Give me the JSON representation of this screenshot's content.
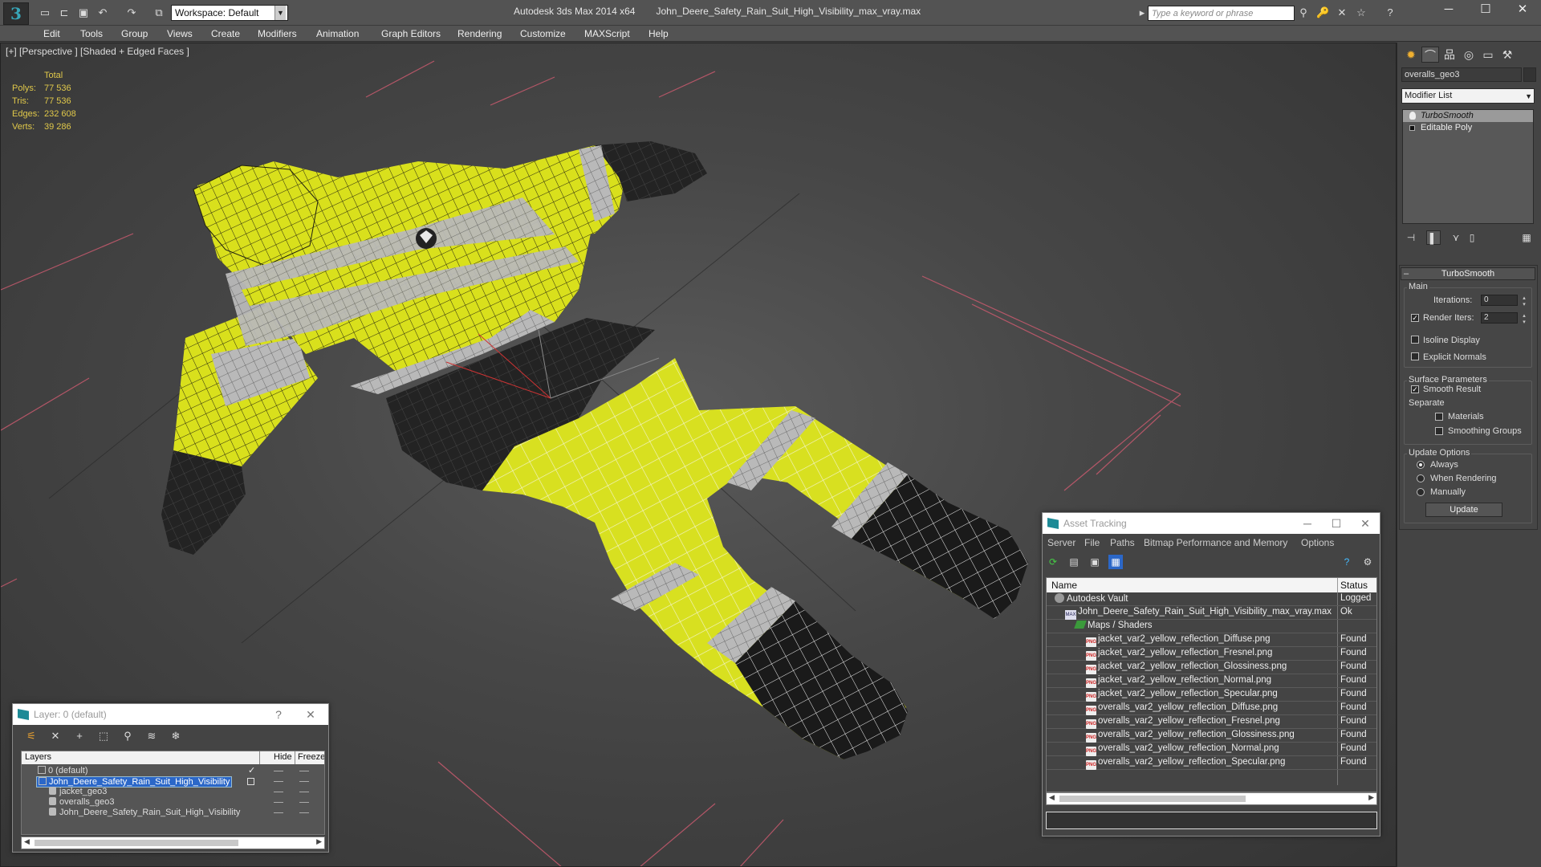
{
  "app": {
    "workspace": "Workspace: Default",
    "product": "Autodesk 3ds Max  2014 x64",
    "filename": "John_Deere_Safety_Rain_Suit_High_Visibility_max_vray.max",
    "search_placeholder": "Type a keyword or phrase"
  },
  "menu": [
    "Edit",
    "Tools",
    "Group",
    "Views",
    "Create",
    "Modifiers",
    "Animation",
    "Graph Editors",
    "Rendering",
    "Customize",
    "MAXScript",
    "Help"
  ],
  "viewport": {
    "label": "[+] [Perspective ] [Shaded + Edged Faces ]",
    "stats_header": "Total",
    "stats": [
      {
        "key": "Polys:",
        "value": "77 536"
      },
      {
        "key": "Tris:",
        "value": "77 536"
      },
      {
        "key": "Edges:",
        "value": "232 608"
      },
      {
        "key": "Verts:",
        "value": "39 286"
      }
    ]
  },
  "command_panel": {
    "object_name": "overalls_geo3",
    "modifier_list": "Modifier List",
    "stack": [
      {
        "label": "TurboSmooth",
        "selected": true
      },
      {
        "label": "Editable Poly",
        "selected": false
      }
    ],
    "rollout_title": "TurboSmooth",
    "main_label": "Main",
    "iterations_label": "Iterations:",
    "iterations_value": "0",
    "render_iters_label": "Render Iters:",
    "render_iters_value": "2",
    "isoline_label": "Isoline Display",
    "explicit_normals_label": "Explicit Normals",
    "surface_params_label": "Surface Parameters",
    "smooth_result_label": "Smooth Result",
    "separate_label": "Separate",
    "materials_label": "Materials",
    "smoothing_groups_label": "Smoothing Groups",
    "update_options_label": "Update Options",
    "always_label": "Always",
    "when_rendering_label": "When Rendering",
    "manually_label": "Manually",
    "update_button": "Update"
  },
  "asset_tracking": {
    "title": "Asset Tracking",
    "menu": [
      "Server",
      "File",
      "Paths",
      "Bitmap Performance and Memory",
      "Options"
    ],
    "col_name": "Name",
    "col_status": "Status",
    "rows": [
      {
        "name": "Autodesk Vault",
        "status": "Logged",
        "kind": "vault",
        "indent": 0
      },
      {
        "name": "John_Deere_Safety_Rain_Suit_High_Visibility_max_vray.max",
        "status": "Ok",
        "kind": "max",
        "indent": 1
      },
      {
        "name": "Maps / Shaders",
        "status": "",
        "kind": "maps",
        "indent": 2
      },
      {
        "name": "jacket_var2_yellow_reflection_Diffuse.png",
        "status": "Found",
        "kind": "png",
        "indent": 3
      },
      {
        "name": "jacket_var2_yellow_reflection_Fresnel.png",
        "status": "Found",
        "kind": "png",
        "indent": 3
      },
      {
        "name": "jacket_var2_yellow_reflection_Glossiness.png",
        "status": "Found",
        "kind": "png",
        "indent": 3
      },
      {
        "name": "jacket_var2_yellow_reflection_Normal.png",
        "status": "Found",
        "kind": "png",
        "indent": 3
      },
      {
        "name": "jacket_var2_yellow_reflection_Specular.png",
        "status": "Found",
        "kind": "png",
        "indent": 3
      },
      {
        "name": "overalls_var2_yellow_reflection_Diffuse.png",
        "status": "Found",
        "kind": "png",
        "indent": 3
      },
      {
        "name": "overalls_var2_yellow_reflection_Fresnel.png",
        "status": "Found",
        "kind": "png",
        "indent": 3
      },
      {
        "name": "overalls_var2_yellow_reflection_Glossiness.png",
        "status": "Found",
        "kind": "png",
        "indent": 3
      },
      {
        "name": "overalls_var2_yellow_reflection_Normal.png",
        "status": "Found",
        "kind": "png",
        "indent": 3
      },
      {
        "name": "overalls_var2_yellow_reflection_Specular.png",
        "status": "Found",
        "kind": "png",
        "indent": 3
      }
    ]
  },
  "layers": {
    "title": "Layer: 0 (default)",
    "help": "?",
    "col_layers": "Layers",
    "col_hide": "Hide",
    "col_freeze": "Freeze",
    "rows": [
      {
        "name": "0 (default)",
        "kind": "layer",
        "indent": 0,
        "selected": false,
        "current": true
      },
      {
        "name": "John_Deere_Safety_Rain_Suit_High_Visibility",
        "kind": "layer",
        "indent": 0,
        "selected": true,
        "current": false
      },
      {
        "name": "jacket_geo3",
        "kind": "object",
        "indent": 1,
        "selected": false,
        "current": false
      },
      {
        "name": "overalls_geo3",
        "kind": "object",
        "indent": 1,
        "selected": false,
        "current": false
      },
      {
        "name": "John_Deere_Safety_Rain_Suit_High_Visibility",
        "kind": "object",
        "indent": 1,
        "selected": false,
        "current": false
      }
    ]
  },
  "colors": {
    "hi_vis_yellow": "#d9e01c",
    "reflective_gray": "#b8b8b8",
    "dark_fabric": "#1e1e1e",
    "stats_text": "#e0c84a",
    "selection_blue": "#2b67c8"
  }
}
